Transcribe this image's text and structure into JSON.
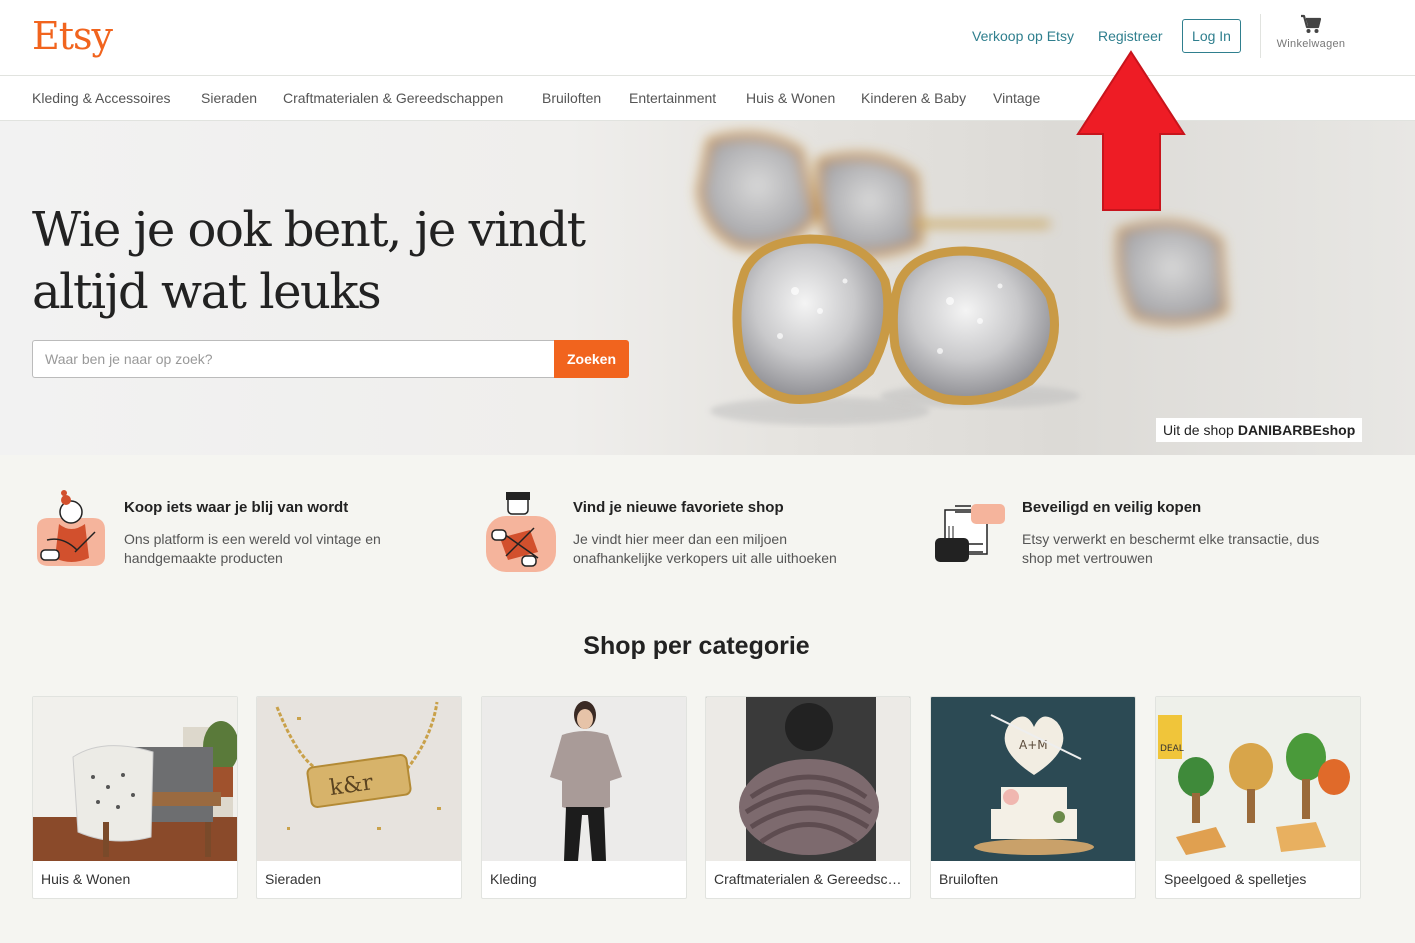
{
  "header": {
    "logo": "Etsy",
    "sell_link": "Verkoop op Etsy",
    "register_link": "Registreer",
    "login_button": "Log In",
    "cart_label": "Winkelwagen"
  },
  "category_nav": [
    "Kleding & Accessoires",
    "Sieraden",
    "Craftmaterialen & Gereedschappen",
    "Bruiloften",
    "Entertainment",
    "Huis & Wonen",
    "Kinderen & Baby",
    "Vintage"
  ],
  "hero": {
    "title": "Wie je ook bent, je vindt altijd wat leuks",
    "search_placeholder": "Waar ben je naar op zoek?",
    "search_button": "Zoeken",
    "credit_prefix": "Uit de shop",
    "credit_shop": "DANIBARBEshop"
  },
  "value_props": [
    {
      "icon": "knitting-person-icon",
      "title": "Koop iets waar je blij van wordt",
      "description": "Ons platform is een wereld vol vintage en handgemaakte producten"
    },
    {
      "icon": "crafting-person-icon",
      "title": "Vind je nieuwe favoriete shop",
      "description": "Je vindt hier meer dan een miljoen onafhankelijke verkopers uit alle uithoeken"
    },
    {
      "icon": "secure-exchange-icon",
      "title": "Beveiligd en veilig kopen",
      "description": "Etsy verwerkt en beschermt elke transactie, dus shop met vertrouwen"
    }
  ],
  "categories_section": {
    "title": "Shop per categorie",
    "cards": [
      {
        "label": "Huis & Wonen"
      },
      {
        "label": "Sieraden"
      },
      {
        "label": "Kleding"
      },
      {
        "label": "Craftmaterialen & Gereedschappen"
      },
      {
        "label": "Bruiloften"
      },
      {
        "label": "Speelgoed & spelletjes"
      }
    ]
  },
  "colors": {
    "brand_orange": "#f1641e",
    "link_teal": "#2f7f8e",
    "annotation_red": "#ee1c25"
  }
}
